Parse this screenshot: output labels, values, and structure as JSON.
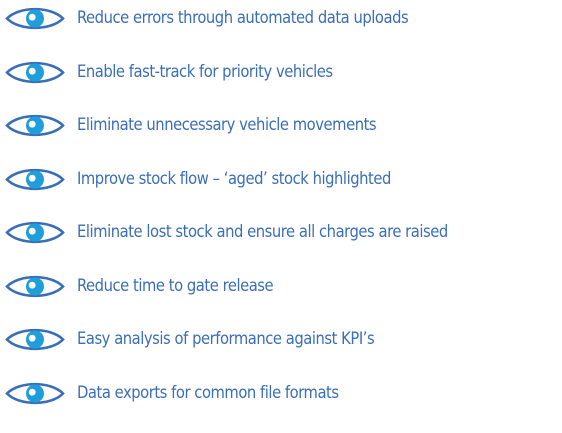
{
  "colors": {
    "text": "#3a6eb8",
    "icon_ring": "#3a6eb8",
    "icon_iris": "#1e9fdb",
    "icon_pupil": "#ffffff"
  },
  "icon_name": "eye-icon",
  "items": [
    {
      "text": "Reduce errors through automated data uploads"
    },
    {
      "text": "Enable fast-track for priority vehicles"
    },
    {
      "text": "Eliminate unnecessary vehicle movements"
    },
    {
      "text": "Improve stock flow – ‘aged’ stock highlighted"
    },
    {
      "text": "Eliminate lost stock and ensure all charges are raised"
    },
    {
      "text": "Reduce time to gate release"
    },
    {
      "text": "Easy analysis of performance against KPI’s"
    },
    {
      "text": "Data exports for common file formats"
    }
  ]
}
